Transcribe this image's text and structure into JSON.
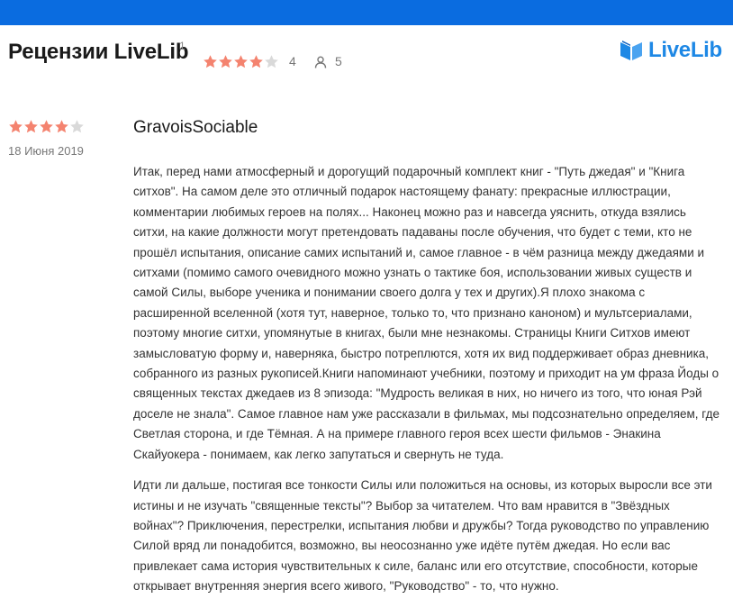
{
  "header": {
    "title": "Рецензии LiveLib",
    "title_sup": "1",
    "rating_value": 4,
    "rating_max": 5,
    "rating_label": "4",
    "reviewers_count": "5",
    "logo_text": "LiveLib"
  },
  "colors": {
    "brand_blue": "#0a6ce0",
    "logo_blue": "#1e88e5",
    "star_filled": "#f4836f",
    "star_empty": "#d9d9d9"
  },
  "icons": {
    "star": "star-icon",
    "user": "user-icon",
    "logo": "book-logo-icon"
  },
  "review": {
    "rating_value": 4,
    "rating_max": 5,
    "date": "18 Июня 2019",
    "author": "GravoisSociable",
    "paragraphs": [
      "Итак, перед нами атмосферный и дорогущий подарочный комплект книг - \"Путь джедая\" и \"Книга ситхов\". На самом деле это отличный подарок настоящему фанату: прекрасные иллюстрации, комментарии любимых героев на полях... Наконец можно раз и навсегда уяснить, откуда взялись ситхи, на какие должности могут претендовать падаваны после обучения, что будет с теми, кто не прошёл испытания, описание самих испытаний и, самое главное - в чём разница между джедаями и ситхами (помимо самого очевидного можно узнать о тактике боя, использовании живых существ и самой Силы, выборе ученика и понимании своего долга у тех и других).Я плохо знакома с расширенной вселенной (хотя тут, наверное, только то, что признано каноном) и мультсериалами, поэтому многие ситхи, упомянутые в книгах, были мне незнакомы. Страницы Книги Ситхов имеют замысловатую форму и, наверняка, быстро потреплются, хотя их вид поддерживает образ дневника, собранного из разных рукописей.Книги напоминают учебники, поэтому и приходит на ум фраза Йоды о священных текстах джедаев из 8 эпизода: \"Мудрость великая в них, но ничего из того, что юная Рэй доселе не знала\". Самое главное нам уже рассказали в фильмах, мы подсознательно определяем, где Светлая сторона, и где Тёмная. А на примере главного героя всех шести фильмов - Энакина Скайуокера - понимаем, как легко запутаться и свернуть не туда.",
      "Идти ли дальше, постигая все тонкости Силы или положиться на основы, из которых выросли все эти истины и не изучать \"священные тексты\"? Выбор за читателем. Что вам нравится в \"Звёздных войнах\"? Приключения, перестрелки, испытания любви и дружбы? Тогда руководство по управлению Силой вряд ли понадобится, возможно, вы неосознанно уже идёте путём джедая. Но если вас привлекает сама история чувствительных к силе, баланс или его отсутствие, способности, которые открывает внутренняя энергия всего живого, \"Руководство\" - то, что нужно."
    ]
  }
}
